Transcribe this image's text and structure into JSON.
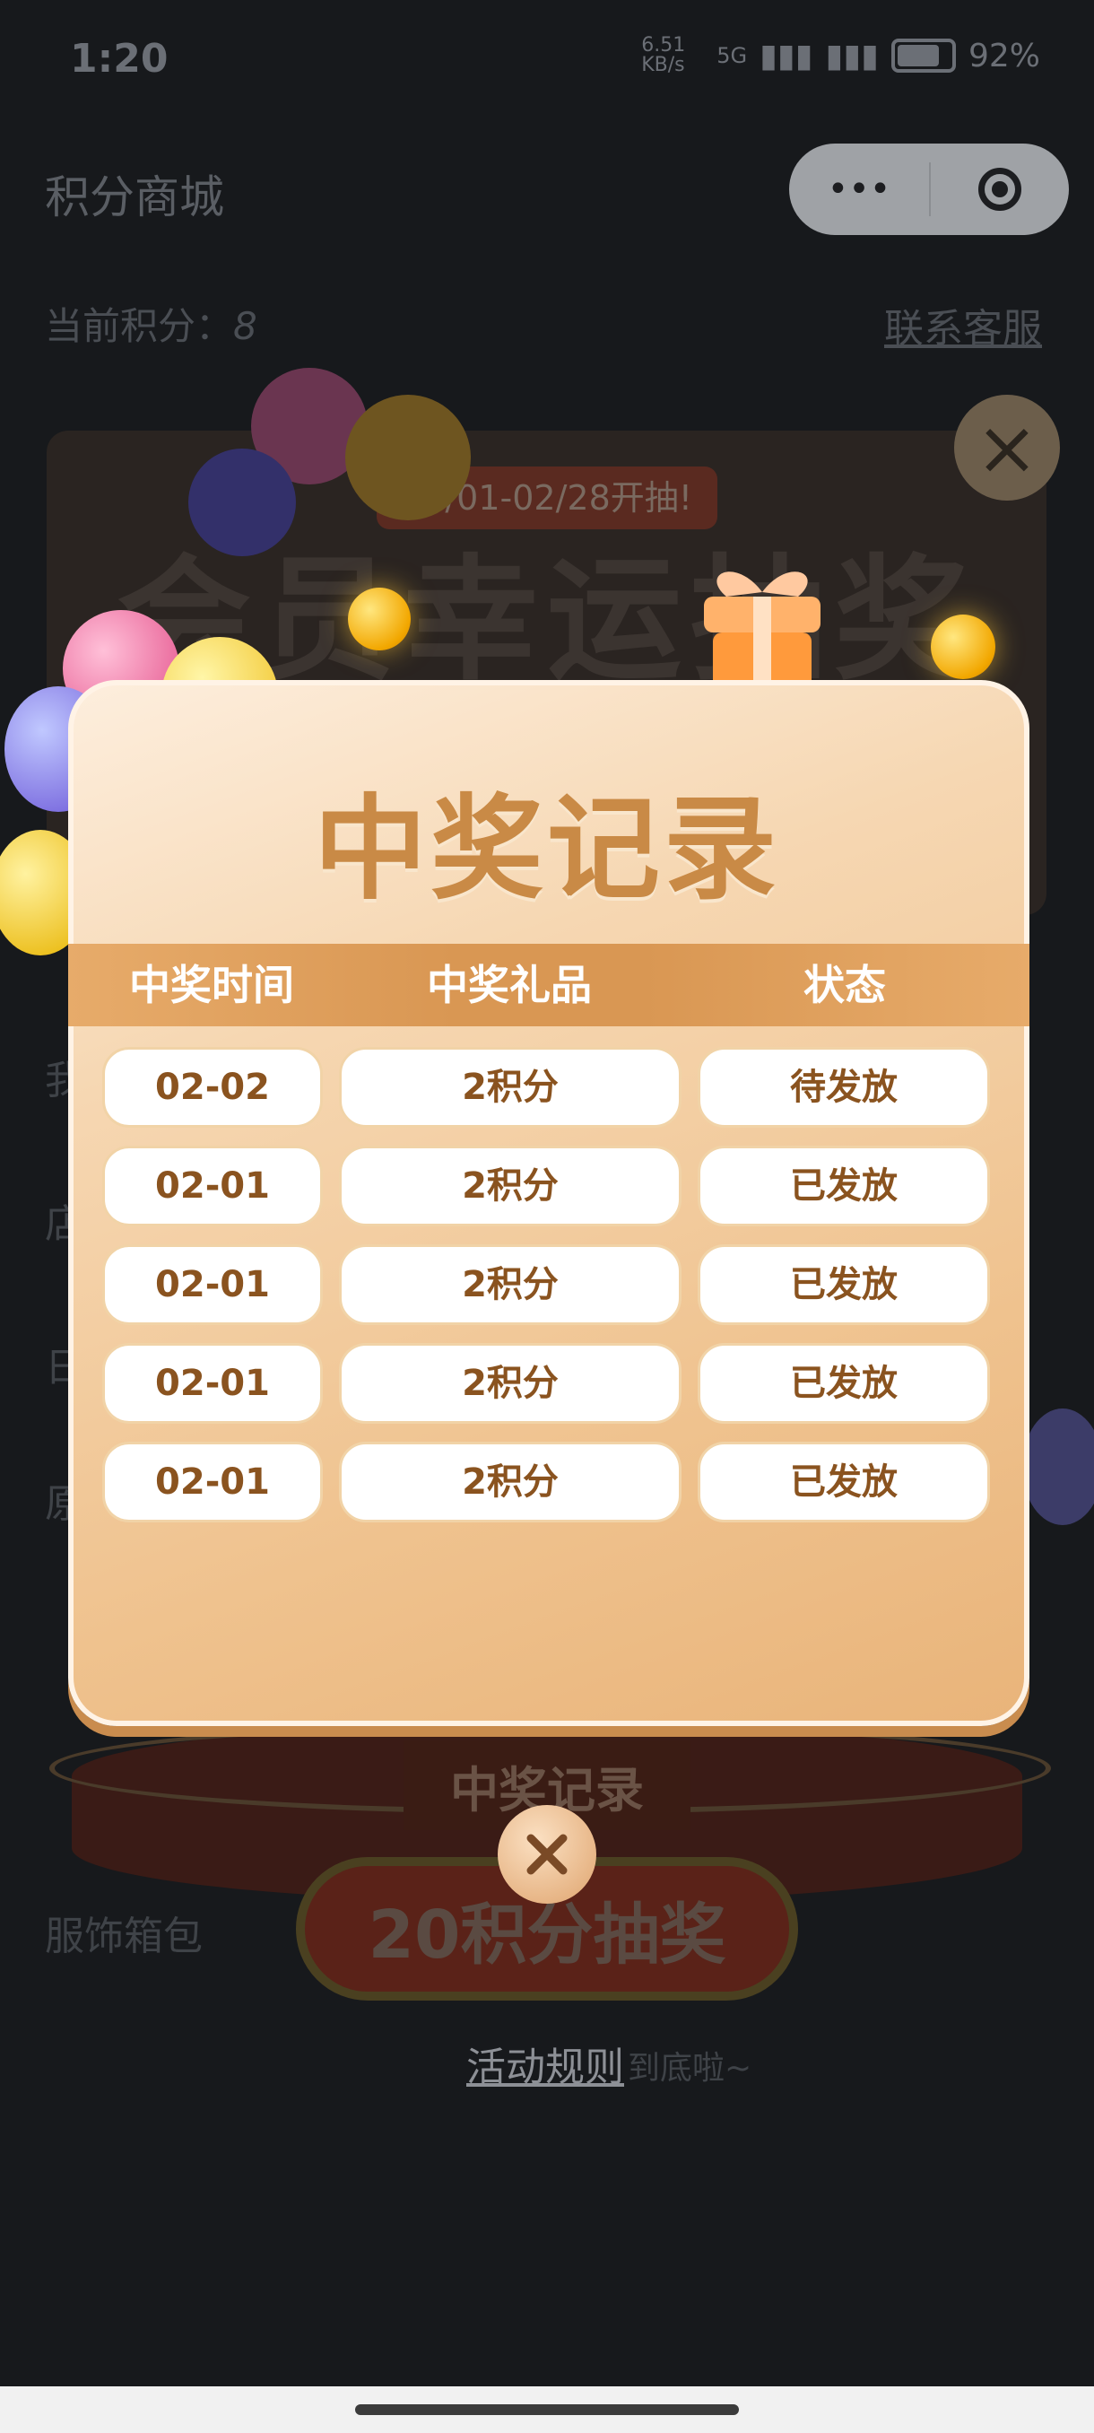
{
  "status_bar": {
    "time": "1:20",
    "network_speed": "6.51 KB/s",
    "network": "5G",
    "battery": "92%"
  },
  "background_page": {
    "title": "积分商城",
    "points_label": "当前积分：",
    "points_value": "8",
    "service_link": "联系客服",
    "banner_date": "02/01-02/28开抽!",
    "banner_title": "会员幸运抽奖",
    "side_items": [
      "我",
      "店",
      "日",
      "原"
    ],
    "category_label": "服饰箱包",
    "record_tab_label": "中奖记录",
    "draw_button_label": "20积分抽奖",
    "rules_link": "活动规则",
    "rules_tail": "到底啦~"
  },
  "modal": {
    "title": "中奖记录",
    "columns": [
      "中奖时间",
      "中奖礼品",
      "状态"
    ],
    "rows": [
      {
        "time": "02-02",
        "prize": "2积分",
        "status": "待发放"
      },
      {
        "time": "02-01",
        "prize": "2积分",
        "status": "已发放"
      },
      {
        "time": "02-01",
        "prize": "2积分",
        "status": "已发放"
      },
      {
        "time": "02-01",
        "prize": "2积分",
        "status": "已发放"
      },
      {
        "time": "02-01",
        "prize": "2积分",
        "status": "已发放"
      }
    ]
  },
  "colors": {
    "accent": "#c98a46",
    "cell_text": "#8a531f",
    "header_band": "#d99753"
  }
}
